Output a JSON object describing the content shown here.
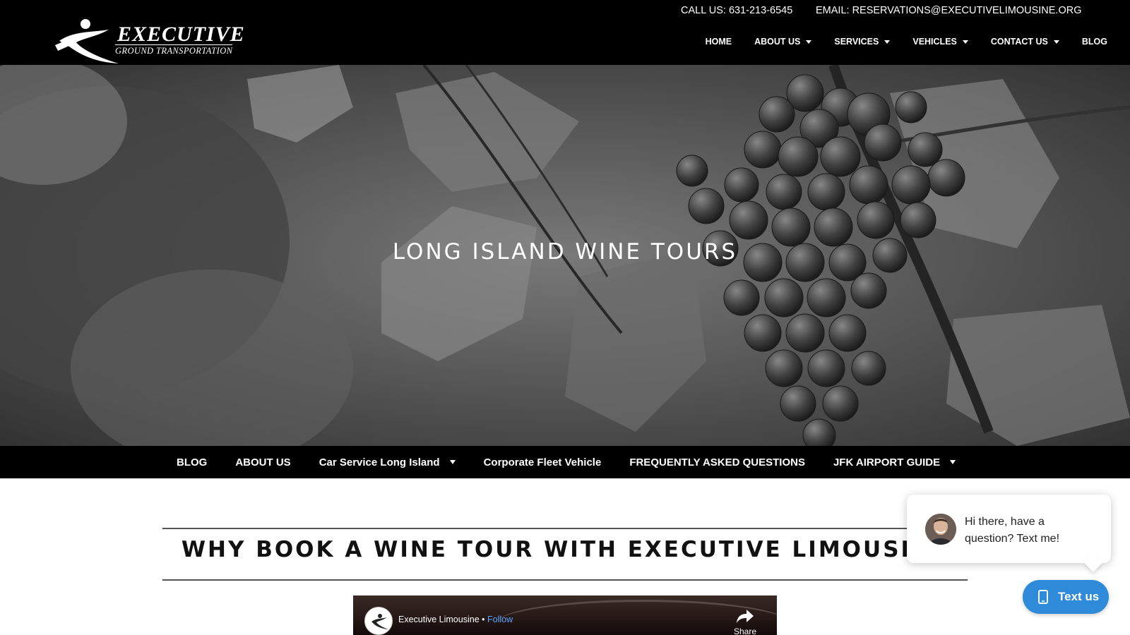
{
  "header": {
    "logo_line1": "EXECUTIVE",
    "logo_line2": "GROUND TRANSPORTATION",
    "phone": "CALL US: 631-213-6545",
    "email": "EMAIL: RESERVATIONS@EXECUTIVELIMOUSINE.ORG",
    "nav": [
      {
        "label": "HOME",
        "dropdown": false
      },
      {
        "label": "ABOUT US",
        "dropdown": true
      },
      {
        "label": "SERVICES",
        "dropdown": true
      },
      {
        "label": "VEHICLES",
        "dropdown": true
      },
      {
        "label": "CONTACT US",
        "dropdown": true
      },
      {
        "label": "BLOG",
        "dropdown": false
      }
    ]
  },
  "hero": {
    "title": "LONG ISLAND WINE TOURS"
  },
  "sub_nav": [
    {
      "label": "BLOG",
      "dropdown": false
    },
    {
      "label": "ABOUT US",
      "dropdown": false
    },
    {
      "label": "Car Service Long Island",
      "dropdown": true
    },
    {
      "label": "Corporate Fleet Vehicle",
      "dropdown": false
    },
    {
      "label": "FREQUENTLY ASKED QUESTIONS",
      "dropdown": false
    },
    {
      "label": "JFK AIRPORT GUIDE",
      "dropdown": true
    }
  ],
  "content": {
    "heading": "WHY BOOK A WINE TOUR WITH EXECUTIVE LIMOUSINE"
  },
  "video": {
    "channel": "Executive Limousine",
    "separator": "•",
    "follow": "Follow",
    "share": "Share"
  },
  "chat": {
    "message": "Hi there, have a question? Text me!",
    "button_label": "Text us",
    "accent": "#2f8bd9"
  }
}
